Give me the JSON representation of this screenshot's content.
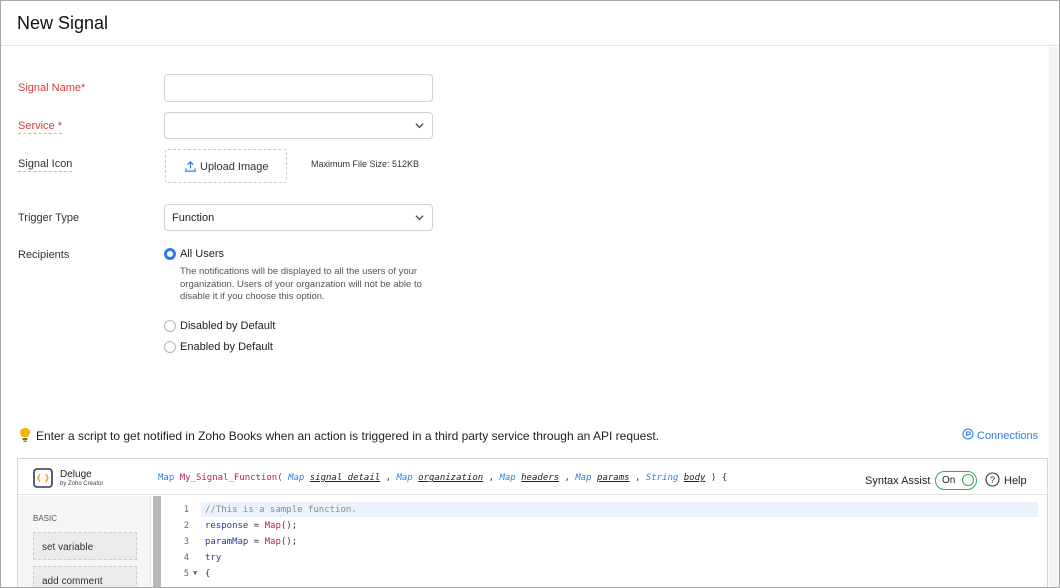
{
  "page": {
    "title": "New Signal"
  },
  "form": {
    "signal_name_label": "Signal Name*",
    "service_label": "Service *",
    "signal_icon_label": "Signal Icon",
    "upload_label": "Upload Image",
    "max_size_text": "Maximum File Size: 512KB",
    "trigger_type_label": "Trigger Type",
    "trigger_type_value": "Function",
    "recipients_label": "Recipients",
    "recipients_options": [
      {
        "label": "All Users",
        "selected": true
      },
      {
        "label": "Disabled by Default",
        "selected": false
      },
      {
        "label": "Enabled by Default",
        "selected": false
      }
    ],
    "all_users_desc": "The notifications will be displayed to all the users of your organization. Users of your organzation will not be able to disable it if you choose this option."
  },
  "tip": {
    "text": "Enter a script to get notified in Zoho Books when an action is triggered in a third party service through an API request.",
    "connections_label": "Connections"
  },
  "editor": {
    "brand_name": "Deluge",
    "brand_sub": "by Zoho Creator",
    "signature": {
      "ret": "Map",
      "name": "My_Signal_Function(",
      "params": [
        {
          "type": "Map",
          "name": "signal_detail"
        },
        {
          "type": "Map",
          "name": "organization"
        },
        {
          "type": "Map",
          "name": "headers"
        },
        {
          "type": "Map",
          "name": "params"
        },
        {
          "type": "String",
          "name": "body"
        }
      ],
      "close": ") {"
    },
    "syntax_assist_label": "Syntax Assist",
    "toggle_label": "On",
    "help_label": "Help",
    "sidebar": {
      "section": "BASIC",
      "items": [
        "set variable",
        "add comment"
      ]
    },
    "code_lines": [
      {
        "n": "1",
        "text": "//This is a sample function."
      },
      {
        "n": "2",
        "a": "response",
        "b": " = ",
        "c": "Map",
        "d": "();"
      },
      {
        "n": "3",
        "a": "paramMap",
        "b": " = ",
        "c": "Map",
        "d": "();"
      },
      {
        "n": "4",
        "text": "try"
      },
      {
        "n": "5",
        "text": "{"
      }
    ]
  },
  "colors": {
    "accent": "#2f7de1",
    "required": "#d93b3b",
    "toggle": "#35a863"
  }
}
